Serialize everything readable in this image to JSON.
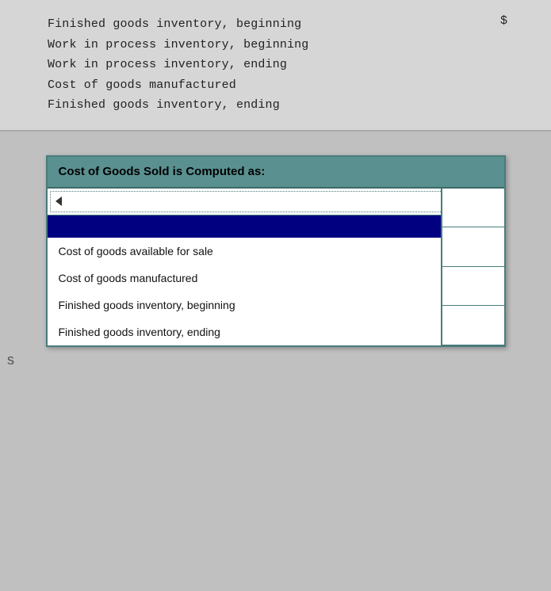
{
  "top_section": {
    "lines": [
      "Finished goods inventory, beginning",
      "Work in process inventory, beginning",
      "Work in process inventory, ending",
      "Cost of goods manufactured",
      "Finished goods inventory, ending"
    ],
    "dollar_sign": "$"
  },
  "dropdown": {
    "header": "Cost of Goods Sold is Computed as:",
    "selected_value": "",
    "list_items": [
      "Cost of goods available for sale",
      "Cost of goods manufactured",
      "Finished goods inventory, beginning",
      "Finished goods inventory, ending"
    ]
  }
}
